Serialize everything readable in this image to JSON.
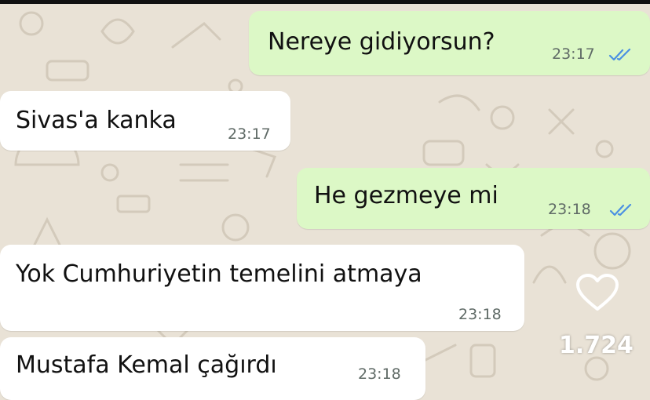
{
  "colors": {
    "outgoing_bubble": "#dcf8c6",
    "incoming_bubble": "#ffffff",
    "wallpaper": "#e9e2d6",
    "read_ticks": "#4a90e2"
  },
  "icons": {
    "read_receipt": "double-check-icon",
    "like": "heart-icon"
  },
  "messages": [
    {
      "direction": "outgoing",
      "text": "Nereye gidiyorsun?",
      "time": "23:17",
      "status": "read"
    },
    {
      "direction": "incoming",
      "text": "Sivas'a kanka",
      "time": "23:17"
    },
    {
      "direction": "outgoing",
      "text": "He gezmeye mi",
      "time": "23:18",
      "status": "read"
    },
    {
      "direction": "incoming",
      "text": "Yok Cumhuriyetin temelini atmaya",
      "time": "23:18"
    },
    {
      "direction": "incoming",
      "text": "Mustafa Kemal çağırdı",
      "time": "23:18"
    }
  ],
  "overlay": {
    "like_count": "1.724"
  }
}
